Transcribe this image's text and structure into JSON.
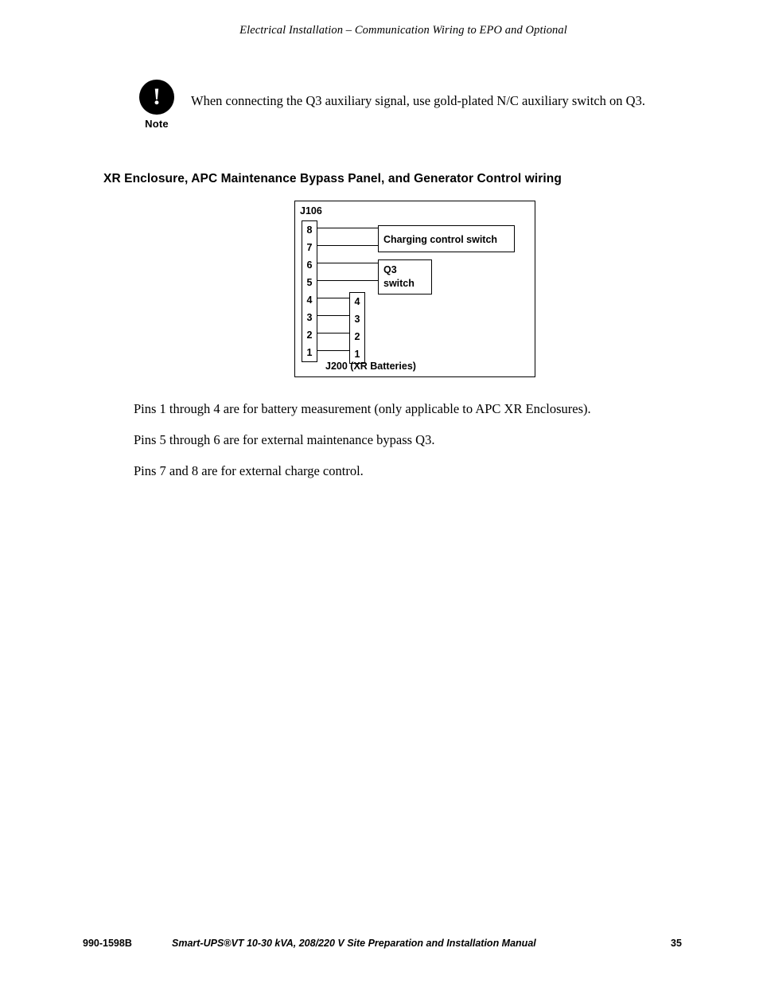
{
  "header": {
    "running_title": "Electrical Installation – Communication Wiring to EPO and Optional"
  },
  "note": {
    "icon_glyph": "!",
    "label": "Note",
    "text": "When connecting the Q3 auxiliary signal, use gold-plated N/C auxiliary switch on Q3."
  },
  "section": {
    "heading": "XR Enclosure, APC Maintenance Bypass Panel, and Generator Control wiring"
  },
  "diagram": {
    "connector_label": "J106",
    "j106_pins": [
      "8",
      "7",
      "6",
      "5",
      "4",
      "3",
      "2",
      "1"
    ],
    "j200_pins": [
      "4",
      "3",
      "2",
      "1"
    ],
    "j200_label": "J200 (XR Batteries)",
    "charging_box_label": "Charging control switch",
    "q3_box_line1": "Q3",
    "q3_box_line2": "switch"
  },
  "body": {
    "p1": "Pins 1 through 4 are for battery measurement (only applicable to APC XR Enclosures).",
    "p2": "Pins 5 through 6 are for external maintenance bypass Q3.",
    "p3": "Pins 7 and 8 are for external charge control."
  },
  "footer": {
    "doc_number": "990-1598B",
    "manual_title": "Smart-UPS®VT 10-30 kVA, 208/220 V Site Preparation and Installation Manual",
    "page_number": "35"
  }
}
